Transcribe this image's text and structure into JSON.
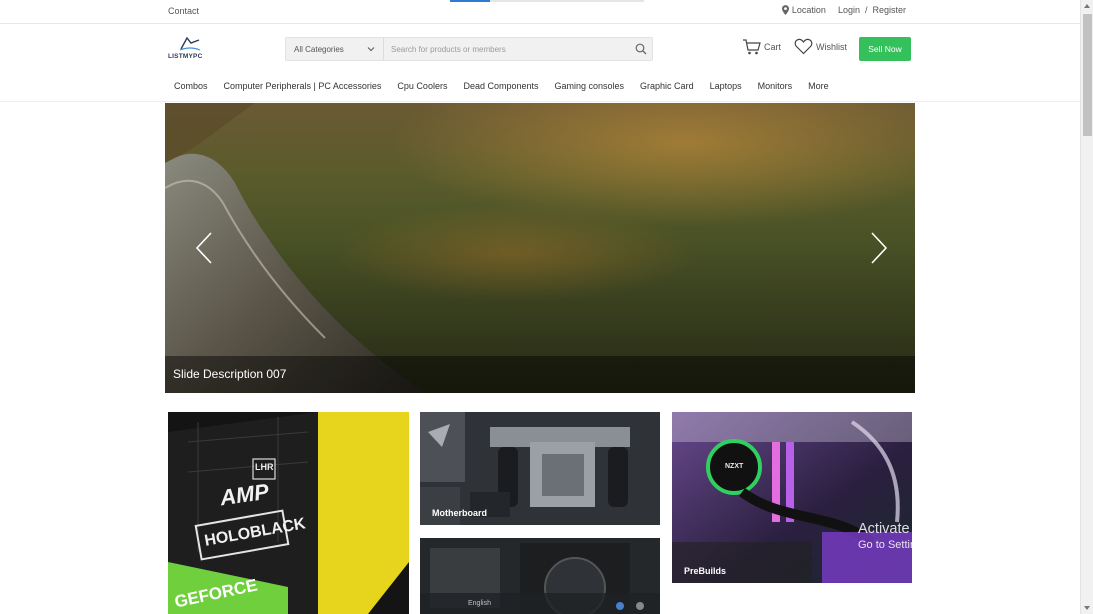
{
  "topbar": {
    "contact": "Contact",
    "location": "Location",
    "login": "Login",
    "separator": "/",
    "register": "Register"
  },
  "header": {
    "logo_text": "LISTMYPC",
    "search": {
      "category_selected": "All Categories",
      "placeholder": "Search for products or members"
    },
    "cart_label": "Cart",
    "wishlist_label": "Wishlist",
    "sell_label": "Sell Now",
    "accent_color": "#34c05a"
  },
  "nav": {
    "items": [
      "Combos",
      "Computer Peripherals | PC Accessories",
      "Cpu Coolers",
      "Dead Components",
      "Gaming consoles",
      "Graphic Card",
      "Laptops",
      "Monitors",
      "More"
    ]
  },
  "hero": {
    "caption": "Slide Description 007"
  },
  "tiles": {
    "motherboard": "Motherboard",
    "prebuilds": "PreBuilds",
    "gpu_box_text": [
      "LHR",
      "AMP",
      "HOLOBLACK",
      "GEFORCE"
    ],
    "pc_fan_text": "NZXT"
  },
  "watermark": {
    "line1": "Activate Windows",
    "line2": "Go to Settings to activate Windows."
  },
  "taskbar_fragment": "English"
}
